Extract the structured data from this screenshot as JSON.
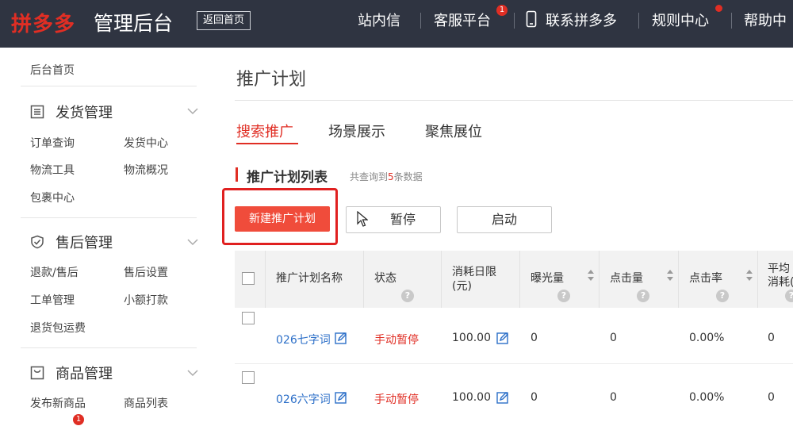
{
  "header": {
    "brand": "拼多多",
    "brand_sub": "管理后台",
    "back_home": "返回首页",
    "nav": [
      {
        "label": "站内信"
      },
      {
        "label": "客服平台",
        "badge": "1"
      },
      {
        "label": "联系拼多多"
      },
      {
        "label": "规则中心",
        "dot": true
      },
      {
        "label": "帮助中"
      }
    ]
  },
  "sidebar": {
    "home": "后台首页",
    "groups": [
      {
        "title": "发货管理",
        "items": [
          "订单查询",
          "发货中心",
          "物流工具",
          "物流概况",
          "包裹中心"
        ]
      },
      {
        "title": "售后管理",
        "items": [
          "退款/售后",
          "售后设置",
          "工单管理",
          "小额打款",
          "退货包运费"
        ]
      },
      {
        "title": "商品管理",
        "items": [
          "发布新商品",
          "商品列表"
        ]
      }
    ],
    "partial_badge": "1"
  },
  "main": {
    "page_title": "推广计划",
    "tabs": [
      {
        "label": "搜索推广",
        "active": true
      },
      {
        "label": "场景展示",
        "active": false
      },
      {
        "label": "聚焦展位",
        "active": false
      }
    ],
    "section_title": "推广计划列表",
    "count_prefix": "共查询到",
    "count_num": "5",
    "count_suffix": "条数据",
    "buttons": {
      "new_plan": "新建推广计划",
      "pause": "暂停",
      "start": "启动"
    },
    "table": {
      "headers": {
        "name": "推广计划名称",
        "status": "状态",
        "budget_line1": "消耗日限",
        "budget_line2": "(元)",
        "impressions": "曝光量",
        "clicks": "点击量",
        "ctr": "点击率",
        "avg_line1": "平均",
        "avg_line2": "消耗("
      },
      "help_glyph": "?",
      "rows": [
        {
          "name": "026七字词",
          "status": "手动暂停",
          "budget": "100.00",
          "impressions": "0",
          "clicks": "0",
          "ctr": "0.00%",
          "avg": "0"
        },
        {
          "name": "026六字词",
          "status": "手动暂停",
          "budget": "100.00",
          "impressions": "0",
          "clicks": "0",
          "ctr": "0.00%",
          "avg": "0"
        }
      ]
    }
  },
  "colors": {
    "accent": "#e02e24",
    "topbar": "#2f3441",
    "link": "#2c6fc8"
  }
}
